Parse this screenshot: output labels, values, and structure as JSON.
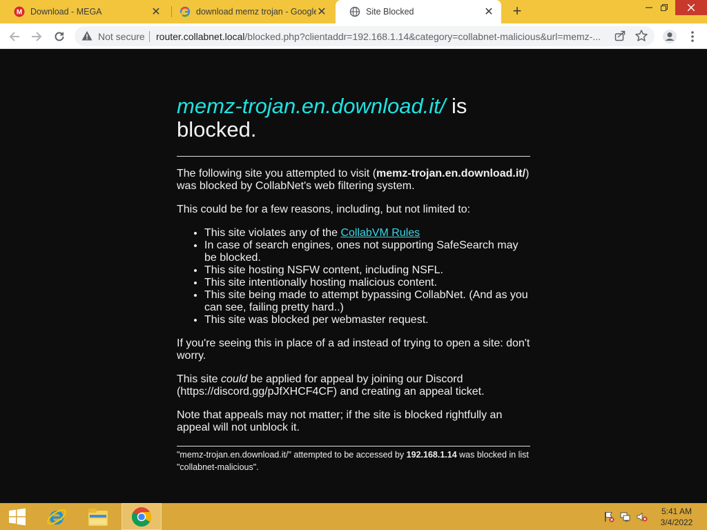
{
  "browser": {
    "tabs": [
      {
        "title": "Download - MEGA",
        "icon": "mega-icon",
        "active": false
      },
      {
        "title": "download memz trojan - Google",
        "icon": "google-icon",
        "active": false
      },
      {
        "title": "Site Blocked",
        "icon": "globe-icon",
        "active": true
      }
    ],
    "new_tab_label": "+",
    "security_label": "Not secure",
    "url_host": "router.collabnet.local",
    "url_path": "/blocked.php?clientaddr=192.168.1.14&category=collabnet-malicious&url=memz-..."
  },
  "page": {
    "blocked_site": "memz-trojan.en.download.it/",
    "headline_suffix_1": "is",
    "headline_suffix_2": "blocked.",
    "p1_before": "The following site you attempted to visit (",
    "p1_site": "memz-trojan.en.download.it/",
    "p1_after": ") was blocked by CollabNet's web filtering system.",
    "p2": "This could be for a few reasons, including, but not limited to:",
    "reason1_before": "This site violates any of the ",
    "reason1_link": "CollabVM Rules",
    "reasons": [
      "In case of search engines, ones not supporting SafeSearch may be blocked.",
      "This site hosting NSFW content, including NSFL.",
      "This site intentionally hosting malicious content.",
      "This site being made to attempt bypassing CollabNet. (And as you can see, failing pretty hard..)",
      "This site was blocked per webmaster request."
    ],
    "p3": "If you're seeing this in place of a ad instead of trying to open a site: don't worry.",
    "p4_before": "This site ",
    "p4_em": "could",
    "p4_after": " be applied for appeal by joining our Discord (https://discord.gg/pJfXHCF4CF) and creating an appeal ticket.",
    "p5": "Note that appeals may not matter; if the site is blocked rightfully an appeal will not unblock it.",
    "foot_1": "\"memz-trojan.en.download.it/\" attempted to be accessed by ",
    "foot_ip": "192.168.1.14",
    "foot_2": " was blocked in list \"collabnet-malicious\"."
  },
  "taskbar": {
    "time": "5:41 AM",
    "date": "3/4/2022",
    "items": [
      "start-icon",
      "internet-explorer-icon",
      "file-explorer-icon",
      "chrome-icon"
    ]
  },
  "colors": {
    "tabstrip": "#f2c53d",
    "blocked_site": "#1ee3e3",
    "link": "#3ad8e8",
    "page_bg": "#0d0d0d",
    "taskbar": "#d9a73a"
  }
}
